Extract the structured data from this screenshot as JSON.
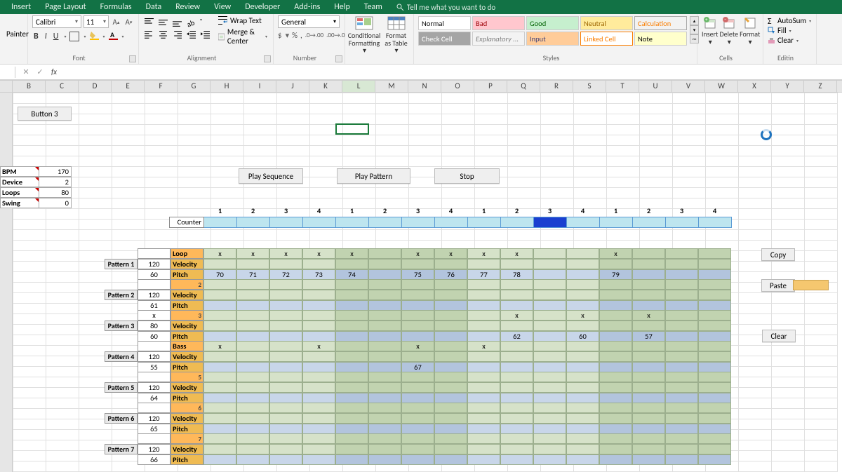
{
  "ribbon": {
    "tabs": [
      "Insert",
      "Page Layout",
      "Formulas",
      "Data",
      "Review",
      "View",
      "Developer",
      "Add-ins",
      "Help",
      "Team"
    ],
    "tellme": "Tell me what you want to do",
    "clipboard": {
      "painter": "Painter"
    },
    "font": {
      "name": "Calibri",
      "size": "11"
    },
    "align": {
      "wrap": "Wrap Text",
      "merge": "Merge & Center"
    },
    "number": {
      "format": "General"
    },
    "cond": {
      "a": "Conditional Formatting",
      "b": "Format as Table"
    },
    "styles": [
      "Normal",
      "Bad",
      "Good",
      "Neutral",
      "Calculation",
      "Check Cell",
      "Explanatory ...",
      "Input",
      "Linked Cell",
      "Note"
    ],
    "cells": [
      "Insert",
      "Delete",
      "Format"
    ],
    "edit": {
      "autosum": "AutoSum",
      "fill": "Fill",
      "clear": "Clear"
    },
    "groupLabels": {
      "font": "Font",
      "align": "Alignment",
      "number": "Number",
      "styles": "Styles",
      "cells": "Cells",
      "edit": "Editin"
    }
  },
  "columns": [
    "B",
    "C",
    "D",
    "E",
    "F",
    "G",
    "H",
    "I",
    "J",
    "K",
    "L",
    "M",
    "N",
    "O",
    "P",
    "Q",
    "R",
    "S",
    "T",
    "U",
    "V",
    "W",
    "X",
    "Y",
    "Z"
  ],
  "activeCol": "L",
  "sheetButton": "Button 3",
  "settings": [
    {
      "label": "BPM",
      "value": 170
    },
    {
      "label": "Device",
      "value": 2
    },
    {
      "label": "Loops",
      "value": 80
    },
    {
      "label": "Swing",
      "value": 0
    }
  ],
  "transport": {
    "play_seq": "Play Sequence",
    "play_pat": "Play Pattern",
    "stop": "Stop"
  },
  "stepHeaders": [
    1,
    2,
    3,
    4,
    1,
    2,
    3,
    4,
    1,
    2,
    3,
    4,
    1,
    2,
    3,
    4
  ],
  "counter": {
    "label": "Counter",
    "active_index": 10
  },
  "patterns": [
    {
      "name": "Pattern 1",
      "head": "Loop",
      "num": "",
      "vel": 120,
      "pitchv": 60,
      "loopRow": [
        "x",
        "x",
        "x",
        "x",
        "x",
        "",
        "x",
        "x",
        "x",
        "x",
        "",
        "",
        "x",
        "",
        "",
        ""
      ],
      "pitchRow": [
        70,
        71,
        72,
        73,
        74,
        "",
        75,
        76,
        77,
        78,
        "",
        "",
        79,
        "",
        "",
        ""
      ]
    },
    {
      "name": "Pattern 2",
      "head": "",
      "num": 2,
      "vel": 120,
      "pitchv": 61,
      "loopRow": [
        "",
        "",
        "",
        "",
        "",
        "",
        "",
        "",
        "",
        "",
        "",
        "",
        "",
        "",
        "",
        ""
      ],
      "pitchRow": [
        "",
        "",
        "",
        "",
        "",
        "",
        "",
        "",
        "",
        "",
        "",
        "",
        "",
        "",
        "",
        ""
      ]
    },
    {
      "name": "Pattern 3",
      "head": "",
      "num": 3,
      "vel": 80,
      "pitchv": 60,
      "topVal": "x",
      "loopRow": [
        "",
        "",
        "",
        "",
        "",
        "",
        "",
        "",
        "",
        "x",
        "",
        "x",
        "",
        "x",
        "",
        ""
      ],
      "pitchRow": [
        "",
        "",
        "",
        "",
        "",
        "",
        "",
        "",
        "",
        62,
        "",
        60,
        "",
        57,
        "",
        ""
      ]
    },
    {
      "name": "Pattern 4",
      "head": "Bass",
      "num": "",
      "vel": 120,
      "pitchv": 55,
      "loopRow": [
        "x",
        "",
        "",
        "x",
        "",
        "",
        "x",
        "",
        "x",
        "",
        "",
        "",
        "",
        "",
        "",
        ""
      ],
      "pitchRow": [
        "",
        "",
        "",
        "",
        "",
        "",
        67,
        "",
        "",
        "",
        "",
        "",
        "",
        "",
        "",
        ""
      ]
    },
    {
      "name": "Pattern 5",
      "head": "",
      "num": 5,
      "vel": 120,
      "pitchv": 64,
      "loopRow": [
        "",
        "",
        "",
        "",
        "",
        "",
        "",
        "",
        "",
        "",
        "",
        "",
        "",
        "",
        "",
        ""
      ],
      "pitchRow": [
        "",
        "",
        "",
        "",
        "",
        "",
        "",
        "",
        "",
        "",
        "",
        "",
        "",
        "",
        "",
        ""
      ]
    },
    {
      "name": "Pattern 6",
      "head": "",
      "num": 6,
      "vel": 120,
      "pitchv": 65,
      "loopRow": [
        "",
        "",
        "",
        "",
        "",
        "",
        "",
        "",
        "",
        "",
        "",
        "",
        "",
        "",
        "",
        ""
      ],
      "pitchRow": [
        "",
        "",
        "",
        "",
        "",
        "",
        "",
        "",
        "",
        "",
        "",
        "",
        "",
        "",
        "",
        ""
      ]
    },
    {
      "name": "Pattern 7",
      "head": "",
      "num": 7,
      "vel": 120,
      "pitchv": 66,
      "loopRow": [
        "",
        "",
        "",
        "",
        "",
        "",
        "",
        "",
        "",
        "",
        "",
        "",
        "",
        "",
        "",
        ""
      ],
      "pitchRow": [
        "",
        "",
        "",
        "",
        "",
        "",
        "",
        "",
        "",
        "",
        "",
        "",
        "",
        "",
        "",
        ""
      ]
    }
  ],
  "util": {
    "copy": "Copy",
    "paste": "Paste",
    "clear": "Clear"
  },
  "rowKinds": {
    "vel": "Velocity",
    "pitch": "Pitch"
  }
}
